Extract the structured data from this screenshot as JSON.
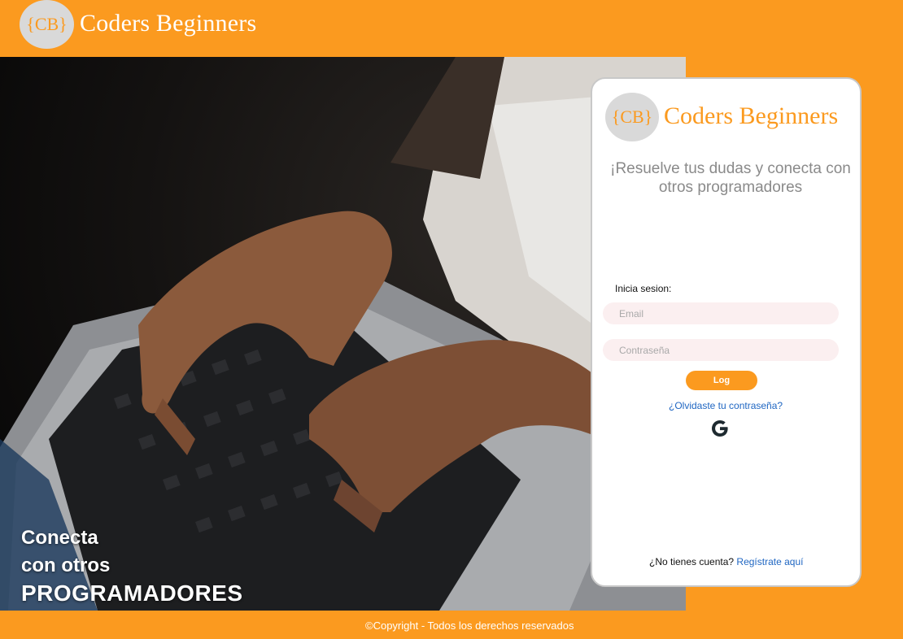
{
  "header": {
    "logo_text": "{CB}",
    "brand": "Coders Beginners"
  },
  "hero": {
    "line1": "Conecta",
    "line2": "con otros",
    "line3": "PROGRAMADORES"
  },
  "card": {
    "logo_text": "{CB}",
    "brand": "Coders Beginners",
    "tagline": "¡Resuelve tus dudas y conecta con otros programadores",
    "login_label": "Inicia sesion:",
    "email_placeholder": "Email",
    "password_placeholder": "Contraseña",
    "login_button": "Log",
    "forgot_link": "¿Olvidaste tu contraseña?",
    "google_icon": "google-icon",
    "signup_prompt": "¿No tienes cuenta?",
    "signup_link": "Regístrate aquí"
  },
  "footer": {
    "copyright": "©Copyright - Todos los derechos reservados"
  },
  "colors": {
    "brand_orange": "#fb9a1f",
    "link_blue": "#1f66c2",
    "field_bg": "#fbeff0",
    "logo_circle": "#d9d9d9"
  }
}
